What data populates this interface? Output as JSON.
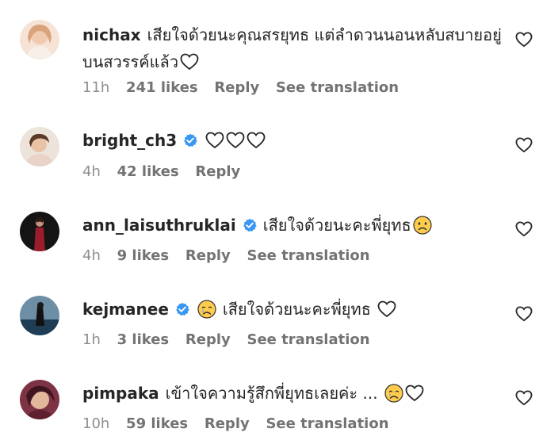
{
  "comments": [
    {
      "username": "nichax",
      "verified": false,
      "text": "เสียใจด้วยนะคุณสรยุทธ แต่ลำดวนนอนหลับสบายอยู่บนสวรรค์แล้ว",
      "trailing_emoji": [
        "heart-outline"
      ],
      "time": "11h",
      "likes": "241 likes",
      "reply": "Reply",
      "translation": "See translation",
      "avatar_color": "#f2d6c4"
    },
    {
      "username": "bright_ch3",
      "verified": true,
      "text": "",
      "trailing_emoji": [
        "heart-outline",
        "heart-outline",
        "heart-outline"
      ],
      "time": "4h",
      "likes": "42 likes",
      "reply": "Reply",
      "translation": "",
      "avatar_color": "#e7dccf"
    },
    {
      "username": "ann_laisuthruklai",
      "verified": true,
      "text": "เสียใจด้วยนะคะพี่ยุทธ",
      "trailing_emoji": [
        "sad-face"
      ],
      "time": "4h",
      "likes": "9 likes",
      "reply": "Reply",
      "translation": "See translation",
      "avatar_color": "#1a1a1a"
    },
    {
      "username": "kejmanee",
      "verified": true,
      "text": "เสียใจด้วยนะคะพี่ยุทธ",
      "leading_emoji": "crying-face",
      "trailing_emoji": [
        "heart-outline"
      ],
      "time": "1h",
      "likes": "3 likes",
      "reply": "Reply",
      "translation": "See translation",
      "avatar_color": "#3c5f7a"
    },
    {
      "username": "pimpaka",
      "verified": false,
      "text": "เข้าใจความรู้สึกพี่ยุทธเลยค่ะ ...",
      "trailing_emoji": [
        "crying-face",
        "heart-outline"
      ],
      "time": "10h",
      "likes": "59 likes",
      "reply": "Reply",
      "translation": "See translation",
      "avatar_color": "#6b2d3a"
    }
  ],
  "colors": {
    "verified_badge": "#3897f0",
    "text_primary": "#262626",
    "text_secondary": "#737373",
    "emoji_yellow": "#ffcc4d"
  }
}
